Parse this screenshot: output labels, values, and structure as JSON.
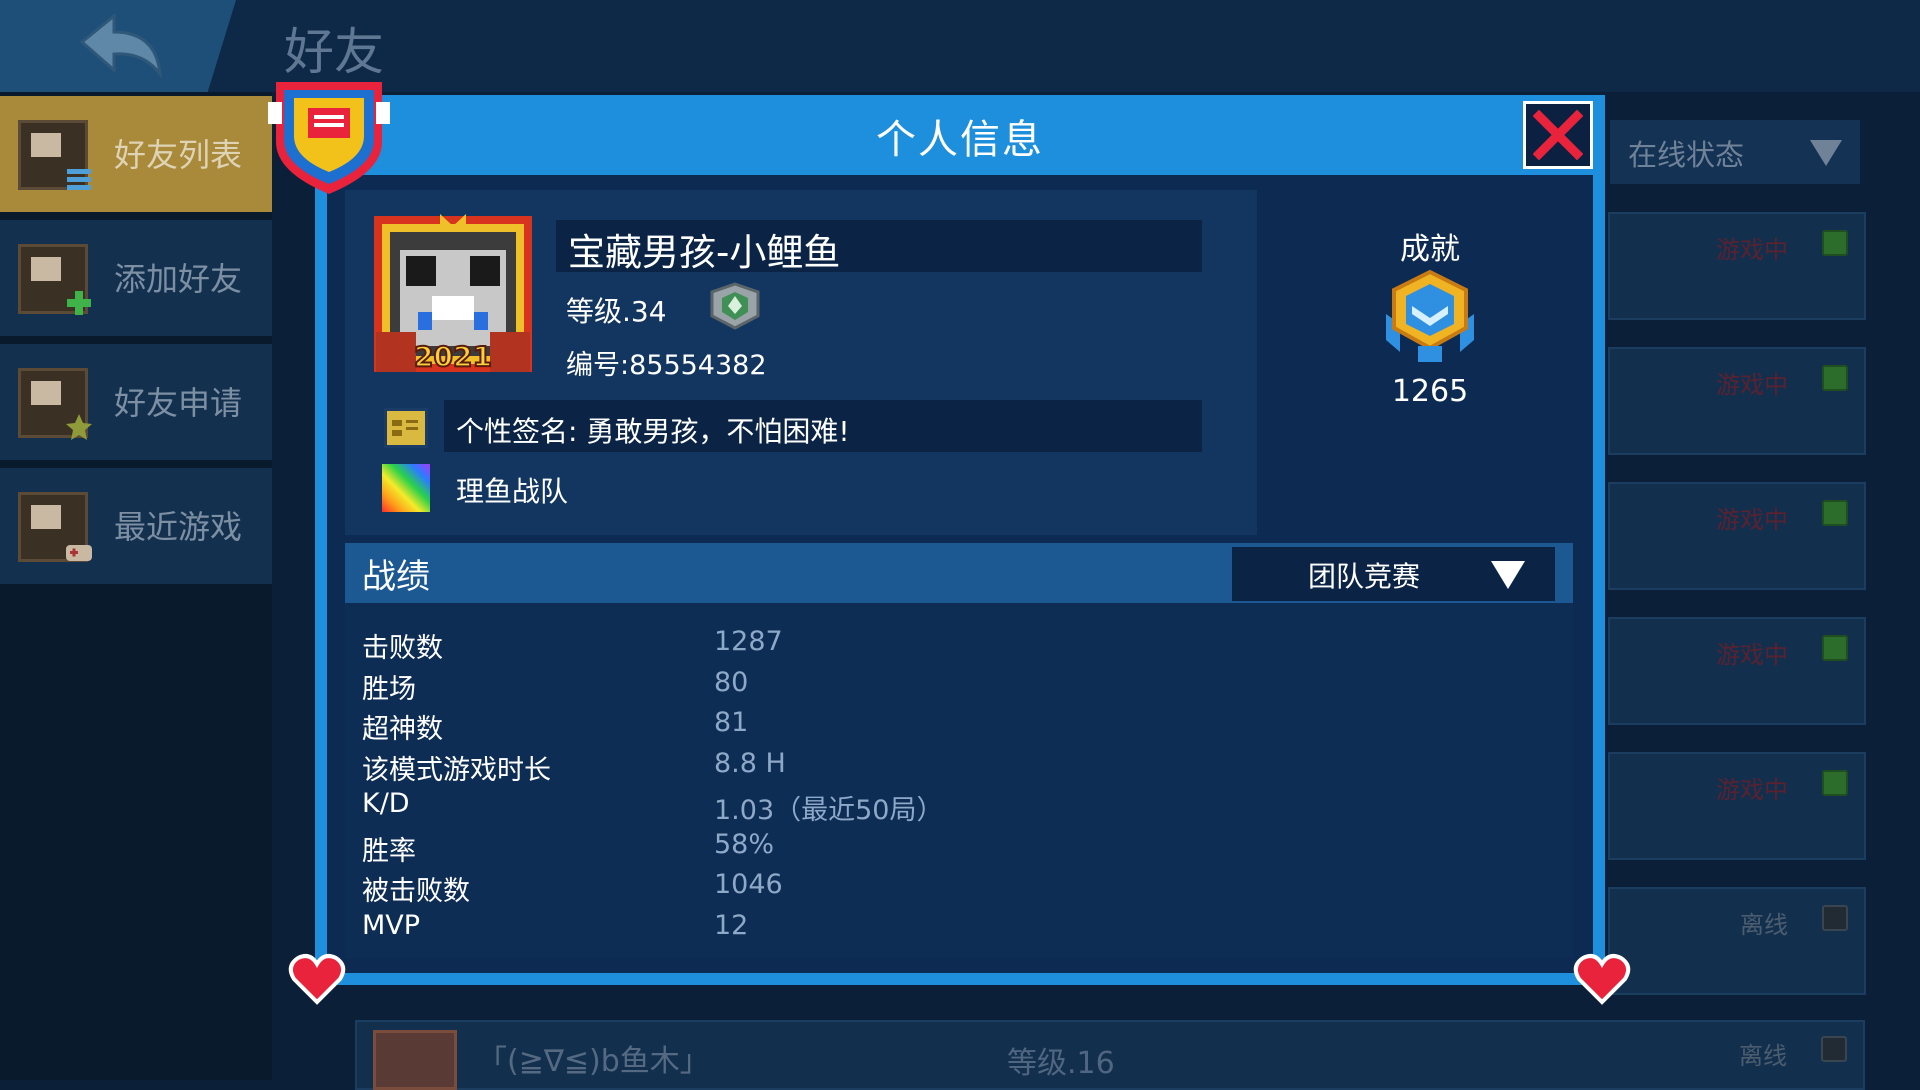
{
  "screen": {
    "title": "好友",
    "filter_label": "在线状态"
  },
  "sidebar": {
    "items": [
      {
        "label": "好友列表",
        "active": true
      },
      {
        "label": "添加好友",
        "active": false
      },
      {
        "label": "好友申请",
        "active": false
      },
      {
        "label": "最近游戏",
        "active": false
      }
    ]
  },
  "background_friends": [
    {
      "status": "游戏中"
    },
    {
      "status": "游戏中"
    },
    {
      "status": "游戏中"
    },
    {
      "status": "游戏中"
    },
    {
      "status": "游戏中"
    },
    {
      "status": "离线"
    }
  ],
  "bottom_friend": {
    "name": "「(≧∇≦)b鱼木」",
    "level": "等级.16",
    "status": "离线"
  },
  "modal": {
    "title": "个人信息",
    "player": {
      "name": "宝藏男孩-小鲤鱼",
      "level": "等级.34",
      "id": "编号:85554382",
      "signature": "个性签名: 勇敢男孩，不怕困难!",
      "team": "理鱼战队",
      "avatar_badge": "2021"
    },
    "achievement": {
      "label": "成就",
      "value": "1265"
    },
    "stats": {
      "title": "战绩",
      "mode": "团队竞赛",
      "rows": [
        {
          "label": "击败数",
          "value": "1287"
        },
        {
          "label": "胜场",
          "value": "80"
        },
        {
          "label": "超神数",
          "value": "81"
        },
        {
          "label": "该模式游戏时长",
          "value": "8.8 H"
        },
        {
          "label": "K/D",
          "value": "1.03（最近50局）"
        },
        {
          "label": "胜率",
          "value": "58%"
        },
        {
          "label": "被击败数",
          "value": "1046"
        },
        {
          "label": "MVP",
          "value": "12"
        }
      ]
    }
  },
  "colors": {
    "modal_border": "#1d8fdc",
    "panel": "#12365f",
    "accent_red": "#e8233b",
    "active_tab": "#a98a3a"
  }
}
